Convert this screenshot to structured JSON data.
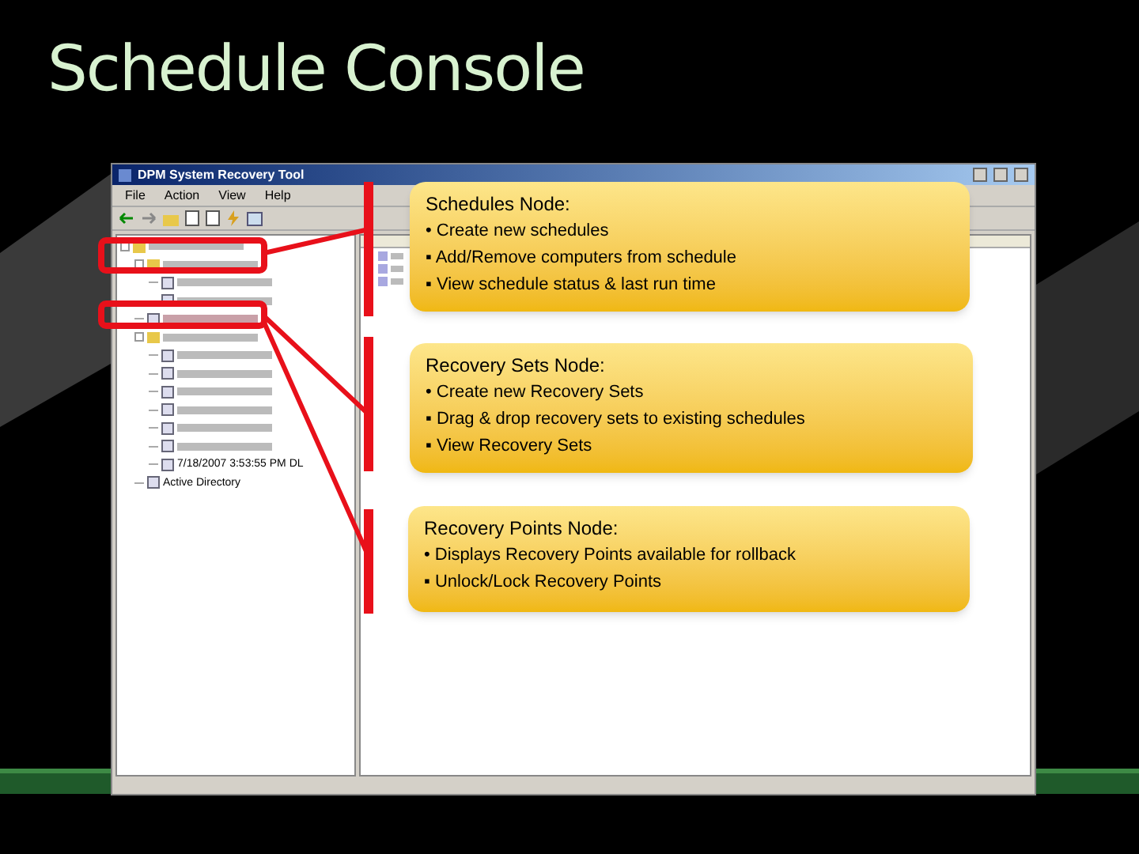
{
  "slide": {
    "title": "Schedule Console"
  },
  "window": {
    "title": "DPM System Recovery Tool",
    "menu": [
      "File",
      "Action",
      "View",
      "Help"
    ],
    "tree": [
      {
        "kind": "blurred",
        "expanded": true,
        "children": [
          {
            "kind": "blurred",
            "expanded": true,
            "children": [
              {
                "kind": "blurred"
              },
              {
                "kind": "blurred"
              }
            ]
          },
          {
            "kind": "blurred",
            "highlighted": true
          },
          {
            "kind": "blurred",
            "expanded": true,
            "children": [
              {
                "kind": "blurred"
              },
              {
                "kind": "blurred"
              },
              {
                "kind": "blurred"
              },
              {
                "kind": "blurred"
              },
              {
                "kind": "blurred"
              },
              {
                "kind": "blurred"
              },
              {
                "kind": "text",
                "label": "7/18/2007 3:53:55 PM DL"
              }
            ]
          },
          {
            "kind": "text",
            "label": "Active Directory"
          }
        ]
      }
    ]
  },
  "callouts": [
    {
      "title": "Schedules Node:",
      "bullets": [
        "• Create new schedules",
        "▪ Add/Remove computers from schedule",
        "▪ View schedule status & last run time"
      ]
    },
    {
      "title": "Recovery Sets Node:",
      "bullets": [
        "• Create new Recovery Sets",
        "▪ Drag & drop recovery sets to existing schedules",
        "▪ View Recovery Sets"
      ]
    },
    {
      "title": "Recovery Points Node:",
      "bullets": [
        "• Displays Recovery Points available for rollback",
        "▪ Unlock/Lock Recovery Points"
      ]
    }
  ]
}
